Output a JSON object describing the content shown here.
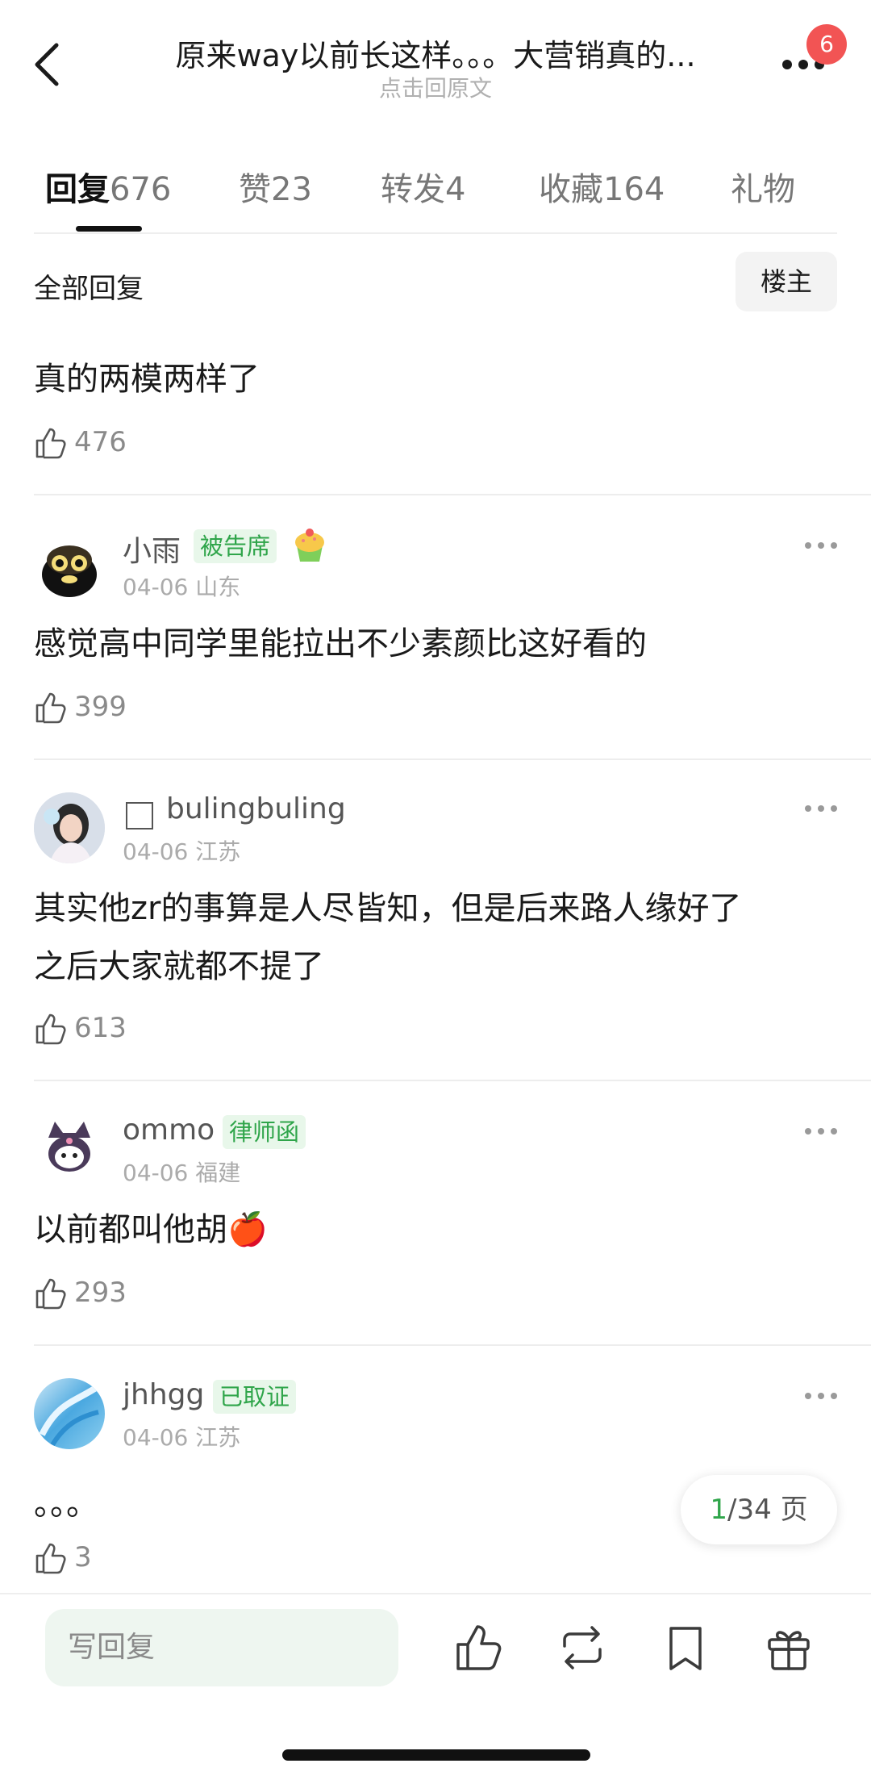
{
  "header": {
    "title": "原来way以前长这样。。。大营销真的...",
    "subtitle": "点击回原文",
    "badge": "6"
  },
  "tabs": [
    {
      "label": "回复",
      "count": "676",
      "active": true
    },
    {
      "label": "赞",
      "count": "23"
    },
    {
      "label": "转发",
      "count": "4"
    },
    {
      "label": "收藏",
      "count": "164"
    },
    {
      "label": "礼物",
      "count": ""
    }
  ],
  "sort": {
    "title": "全部回复",
    "op_button": "楼主"
  },
  "comments": [
    {
      "text": "真的两模两样了",
      "likes": "476"
    },
    {
      "user": "小雨",
      "tag": "被告席",
      "date": "04-06",
      "location": "山东",
      "text": "感觉高中同学里能拉出不少素颜比这好看的",
      "likes": "399"
    },
    {
      "user": "bulingbuling",
      "date": "04-06",
      "location": "江苏",
      "text_line1": "其实他zr的事算是人尽皆知，但是后来路人缘好了",
      "text_line2": "之后大家就都不提了",
      "likes": "613"
    },
    {
      "user": "ommo",
      "tag": "律师函",
      "date": "04-06",
      "location": "福建",
      "text": "以前都叫他胡🍎",
      "likes": "293"
    },
    {
      "user": "jhhgg",
      "tag": "已取证",
      "date": "04-06",
      "location": "江苏",
      "text": "。。。",
      "likes": "3"
    }
  ],
  "pager": {
    "current": "1",
    "total": "/34 页"
  },
  "bottom": {
    "reply_placeholder": "写回复"
  },
  "colors": {
    "accent": "#2fa54a",
    "badge": "#f25454",
    "tag_bg": "#e8f7ea"
  },
  "icons": [
    "back-arrow-icon",
    "more-icon",
    "thumbs-up-icon",
    "repost-icon",
    "bookmark-icon",
    "gift-icon"
  ]
}
